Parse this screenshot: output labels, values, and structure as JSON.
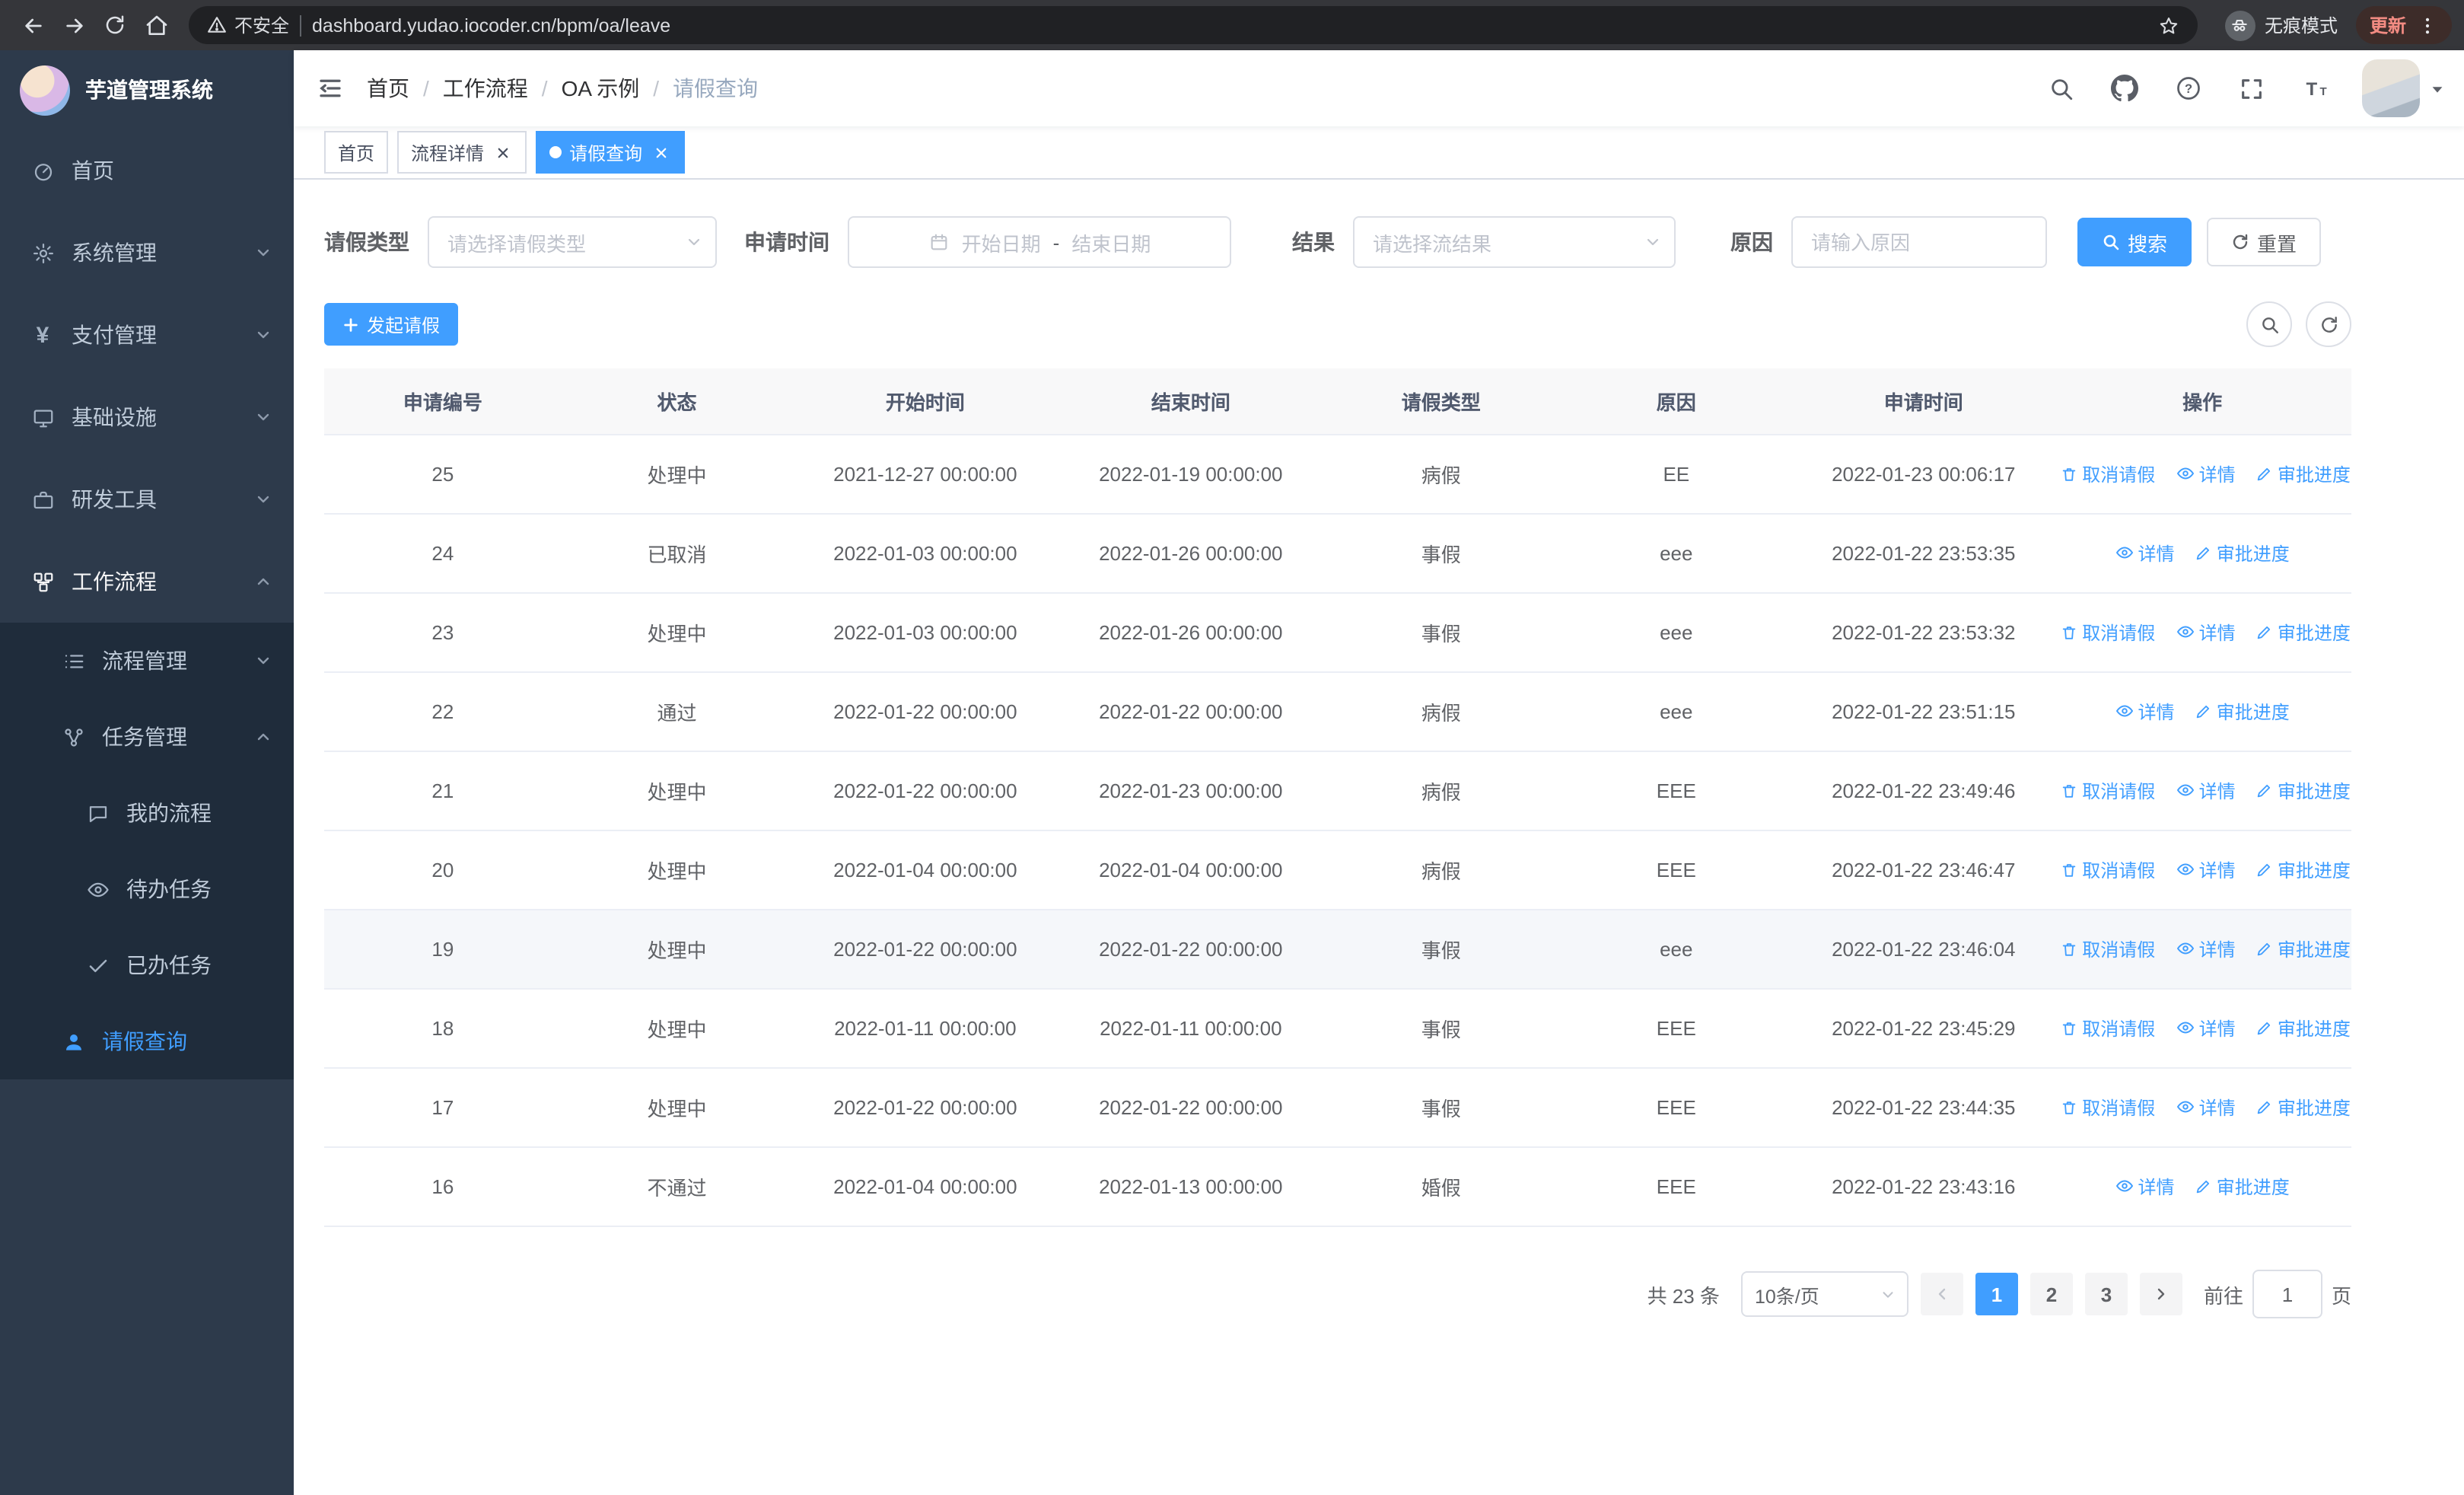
{
  "browser": {
    "security_label": "不安全",
    "url": "dashboard.yudao.iocoder.cn/bpm/oa/leave",
    "incognito_label": "无痕模式",
    "update_label": "更新"
  },
  "icons": {
    "yen": "¥",
    "question": "?",
    "font_size_large": "T",
    "font_size_small": "T"
  },
  "sidebar": {
    "title": "芋道管理系统",
    "items": {
      "home": "首页",
      "system": "系统管理",
      "payment": "支付管理",
      "infra": "基础设施",
      "devtools": "研发工具",
      "workflow": "工作流程",
      "process_mgmt": "流程管理",
      "task_mgmt": "任务管理",
      "my_process": "我的流程",
      "todo_tasks": "待办任务",
      "done_tasks": "已办任务",
      "leave_query": "请假查询"
    }
  },
  "breadcrumb": {
    "separator": "/",
    "items": [
      "首页",
      "工作流程",
      "OA 示例",
      "请假查询"
    ]
  },
  "tabs": [
    {
      "label": "首页"
    },
    {
      "label": "流程详情"
    },
    {
      "label": "请假查询"
    }
  ],
  "filters": {
    "leave_type_label": "请假类型",
    "leave_type_placeholder": "请选择请假类型",
    "apply_time_label": "申请时间",
    "start_date_placeholder": "开始日期",
    "range_separator": "-",
    "end_date_placeholder": "结束日期",
    "result_label": "结果",
    "result_placeholder": "请选择流结果",
    "reason_label": "原因",
    "reason_placeholder": "请输入原因",
    "search_label": "搜索",
    "reset_label": "重置"
  },
  "actions": {
    "create_label": "发起请假"
  },
  "table": {
    "columns": [
      "申请编号",
      "状态",
      "开始时间",
      "结束时间",
      "请假类型",
      "原因",
      "申请时间",
      "操作"
    ],
    "ops": {
      "cancel": "取消请假",
      "detail": "详情",
      "progress": "审批进度"
    },
    "highlighted_id": "19",
    "rows": [
      {
        "id": "25",
        "status": "处理中",
        "start": "2021-12-27 00:00:00",
        "end": "2022-01-19 00:00:00",
        "type": "病假",
        "reason": "EE",
        "apply": "2022-01-23 00:06:17",
        "cancelable": true
      },
      {
        "id": "24",
        "status": "已取消",
        "start": "2022-01-03 00:00:00",
        "end": "2022-01-26 00:00:00",
        "type": "事假",
        "reason": "eee",
        "apply": "2022-01-22 23:53:35",
        "cancelable": false
      },
      {
        "id": "23",
        "status": "处理中",
        "start": "2022-01-03 00:00:00",
        "end": "2022-01-26 00:00:00",
        "type": "事假",
        "reason": "eee",
        "apply": "2022-01-22 23:53:32",
        "cancelable": true
      },
      {
        "id": "22",
        "status": "通过",
        "start": "2022-01-22 00:00:00",
        "end": "2022-01-22 00:00:00",
        "type": "病假",
        "reason": "eee",
        "apply": "2022-01-22 23:51:15",
        "cancelable": false
      },
      {
        "id": "21",
        "status": "处理中",
        "start": "2022-01-22 00:00:00",
        "end": "2022-01-23 00:00:00",
        "type": "病假",
        "reason": "EEE",
        "apply": "2022-01-22 23:49:46",
        "cancelable": true
      },
      {
        "id": "20",
        "status": "处理中",
        "start": "2022-01-04 00:00:00",
        "end": "2022-01-04 00:00:00",
        "type": "病假",
        "reason": "EEE",
        "apply": "2022-01-22 23:46:47",
        "cancelable": true
      },
      {
        "id": "19",
        "status": "处理中",
        "start": "2022-01-22 00:00:00",
        "end": "2022-01-22 00:00:00",
        "type": "事假",
        "reason": "eee",
        "apply": "2022-01-22 23:46:04",
        "cancelable": true
      },
      {
        "id": "18",
        "status": "处理中",
        "start": "2022-01-11 00:00:00",
        "end": "2022-01-11 00:00:00",
        "type": "事假",
        "reason": "EEE",
        "apply": "2022-01-22 23:45:29",
        "cancelable": true
      },
      {
        "id": "17",
        "status": "处理中",
        "start": "2022-01-22 00:00:00",
        "end": "2022-01-22 00:00:00",
        "type": "事假",
        "reason": "EEE",
        "apply": "2022-01-22 23:44:35",
        "cancelable": true
      },
      {
        "id": "16",
        "status": "不通过",
        "start": "2022-01-04 00:00:00",
        "end": "2022-01-13 00:00:00",
        "type": "婚假",
        "reason": "EEE",
        "apply": "2022-01-22 23:43:16",
        "cancelable": false
      }
    ]
  },
  "pagination": {
    "total_text": "共 23 条",
    "page_size_text": "10条/页",
    "pages": [
      "1",
      "2",
      "3"
    ],
    "active_page": "1",
    "goto_prefix": "前往",
    "goto_value": "1",
    "goto_suffix": "页"
  }
}
